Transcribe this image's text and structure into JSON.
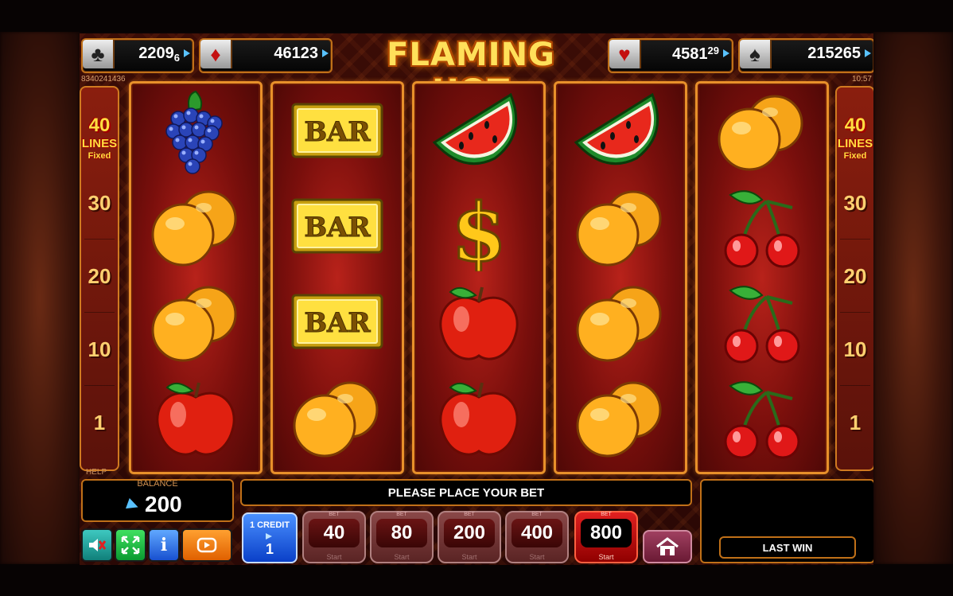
{
  "game_title": "FLAMING HOT",
  "jackpots": [
    {
      "suit": "clubs",
      "suit_glyph": "♣",
      "main": "2209",
      "frac": "6",
      "frac_style": "sub"
    },
    {
      "suit": "diamonds",
      "suit_glyph": "♦",
      "main": "46123",
      "frac": "",
      "frac_style": "none"
    },
    {
      "suit": "hearts",
      "suit_glyph": "♥",
      "main": "4581",
      "frac": "29",
      "frac_style": "sup"
    },
    {
      "suit": "spades",
      "suit_glyph": "♠",
      "main": "215265",
      "frac": "",
      "frac_style": "none"
    }
  ],
  "session_id": "8340241436",
  "clock": "10:57",
  "lines_panel": {
    "count": "40",
    "label": "LINES",
    "mode": "Fixed",
    "markers": [
      "30",
      "20",
      "10",
      "1"
    ]
  },
  "reels": [
    [
      "grapes",
      "orange",
      "orange",
      "apple"
    ],
    [
      "bar",
      "bar",
      "bar",
      "orange"
    ],
    [
      "watermelon",
      "dollar",
      "apple",
      "apple"
    ],
    [
      "watermelon",
      "orange",
      "orange",
      "orange"
    ],
    [
      "orange",
      "cherry",
      "cherry",
      "cherry"
    ]
  ],
  "bar_text": "BAR",
  "dollar_text": "$",
  "help_label": "HELP",
  "balance": {
    "caption": "BALANCE",
    "amount": "200"
  },
  "status_message": "PLEASE PLACE YOUR BET",
  "last_win_label": "LAST WIN",
  "credit": {
    "label": "1 CREDIT",
    "value": "1"
  },
  "bets": [
    {
      "top": "BET",
      "value": "40",
      "sub": "Start",
      "active": false
    },
    {
      "top": "BET",
      "value": "80",
      "sub": "Start",
      "active": false
    },
    {
      "top": "BET",
      "value": "200",
      "sub": "Start",
      "active": false
    },
    {
      "top": "BET",
      "value": "400",
      "sub": "Start",
      "active": false
    },
    {
      "top": "BET",
      "value": "800",
      "sub": "Start",
      "active": true
    }
  ],
  "icons": {
    "sound": "sound-muted-icon",
    "fullscreen": "fullscreen-icon",
    "info": "info-icon",
    "autoplay": "autoplay-icon",
    "home": "home-icon"
  },
  "info_glyph": "i",
  "colors": {
    "accent": "#e8902a",
    "reel": "#a81a14",
    "title": "#ffe05a",
    "bet_active": "#e02020"
  }
}
